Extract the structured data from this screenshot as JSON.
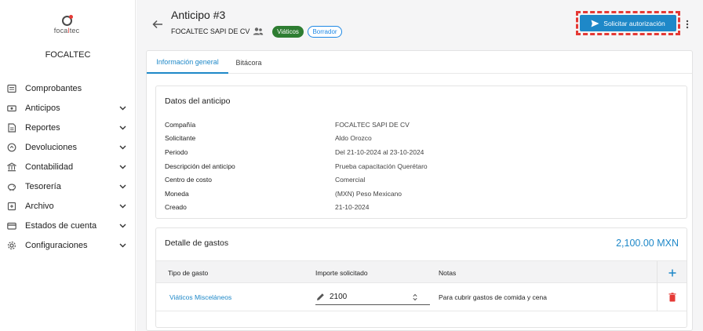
{
  "brand": {
    "logo_prefix": "foca",
    "logo_accent": "l",
    "logo_suffix": "tec",
    "company": "FOCALTEC"
  },
  "sidebar": {
    "items": [
      {
        "label": "Comprobantes",
        "icon": "receipt-icon",
        "has_chevron": false
      },
      {
        "label": "Anticipos",
        "icon": "cash-icon",
        "has_chevron": true
      },
      {
        "label": "Reportes",
        "icon": "document-icon",
        "has_chevron": true
      },
      {
        "label": "Devoluciones",
        "icon": "refund-icon",
        "has_chevron": true
      },
      {
        "label": "Contabilidad",
        "icon": "bank-icon",
        "has_chevron": true
      },
      {
        "label": "Tesorería",
        "icon": "piggy-bank-icon",
        "has_chevron": true
      },
      {
        "label": "Archivo",
        "icon": "archive-icon",
        "has_chevron": true
      },
      {
        "label": "Estados de cuenta",
        "icon": "card-icon",
        "has_chevron": true
      },
      {
        "label": "Configuraciones",
        "icon": "gear-icon",
        "has_chevron": true
      }
    ]
  },
  "header": {
    "title": "Anticipo #3",
    "company": "FOCALTEC SAPI DE CV",
    "chips": {
      "type": "Viáticos",
      "status": "Borrador"
    },
    "action_button": "Solicitar autorización"
  },
  "tabs": [
    {
      "label": "Información general",
      "active": true
    },
    {
      "label": "Bitácora",
      "active": false
    }
  ],
  "datos": {
    "title": "Datos del anticipo",
    "rows": [
      {
        "label": "Compañía",
        "value": "FOCALTEC SAPI DE CV"
      },
      {
        "label": "Solicitante",
        "value": "Aldo Orozco"
      },
      {
        "label": "Periodo",
        "value": "Del 21-10-2024 al 23-10-2024"
      },
      {
        "label": "Descripción del anticipo",
        "value": "Prueba capacitación Querétaro"
      },
      {
        "label": "Centro de costo",
        "value": "Comercial"
      },
      {
        "label": "Moneda",
        "value": "(MXN) Peso Mexicano"
      },
      {
        "label": "Creado",
        "value": "21-10-2024"
      }
    ]
  },
  "gastos": {
    "title": "Detalle de gastos",
    "total": "2,100.00 MXN",
    "columns": {
      "tipo": "Tipo de gasto",
      "importe": "Importe solicitado",
      "notas": "Notas"
    },
    "rows": [
      {
        "tipo": "Viáticos Misceláneos",
        "importe": "2100",
        "notas": "Para cubrir gastos de comida y cena"
      }
    ]
  },
  "colors": {
    "primary": "#1e88c8",
    "chip_green": "#2e7d32",
    "highlight": "#e53935",
    "delete": "#e53935"
  }
}
